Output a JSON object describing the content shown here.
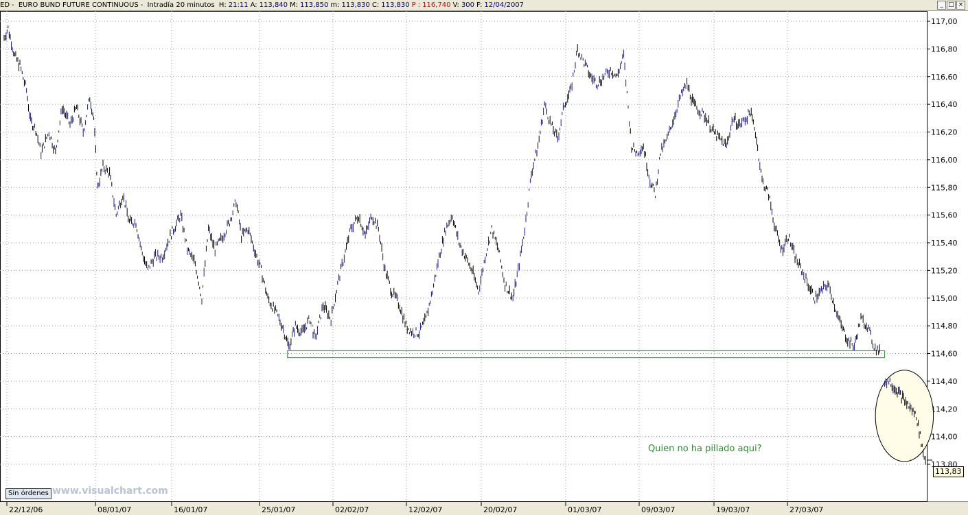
{
  "header": {
    "prefix": "ED",
    "title": "EURO BUND FUTURE CONTINUOUS",
    "interval": "Intradía 20 minutos",
    "items": [
      {
        "label": "H:",
        "value": "21:11",
        "color": "blue"
      },
      {
        "label": "A:",
        "value": "113,840",
        "color": "blue"
      },
      {
        "label": "M:",
        "value": "113,850",
        "color": "blue"
      },
      {
        "label": "m:",
        "value": "113,830",
        "color": "blue"
      },
      {
        "label": "C:",
        "value": "113,830",
        "color": "blue"
      },
      {
        "label": "P :",
        "value": "116,740",
        "color": "red"
      },
      {
        "label": "V:",
        "value": "300",
        "color": "blue"
      },
      {
        "label": "F:",
        "value": "12/04/2007",
        "color": "blue"
      }
    ],
    "window_buttons": [
      "_",
      "□",
      "×"
    ]
  },
  "footer": {
    "orders_badge": "Sin órdenes",
    "watermark": "www.visualchart.com"
  },
  "colors": {
    "up_bar": "#1a1a8c",
    "down_bar": "#000000",
    "grid": "#9a9a9a",
    "support_box": "#3c9b3c",
    "ellipse_fill": "#fffde7",
    "annotation": "#2e8b2e"
  },
  "chart_data": {
    "type": "line",
    "style": "intraday price bars, 20 minutes",
    "ylim": [
      113.8,
      117.1
    ],
    "y_ticks": [
      "113,80",
      "114,00",
      "114,20",
      "114,40",
      "114,60",
      "114,80",
      "115,00",
      "115,20",
      "115,40",
      "115,60",
      "115,80",
      "116,00",
      "116,20",
      "116,40",
      "116,60",
      "116,80",
      "117,00"
    ],
    "x_labels": [
      "22/12/06",
      "08/01/07",
      "16/01/07",
      "25/01/07",
      "02/02/07",
      "12/02/07",
      "20/02/07",
      "01/03/07",
      "09/03/07",
      "19/03/07",
      "27/03/07"
    ],
    "grid": true,
    "series": [
      {
        "points": [
          [
            0,
            116.88
          ],
          [
            0.3,
            116.95
          ],
          [
            0.8,
            116.75
          ],
          [
            1.2,
            116.68
          ],
          [
            1.7,
            116.5
          ],
          [
            2.0,
            116.28
          ],
          [
            2.4,
            116.22
          ],
          [
            2.8,
            116.05
          ],
          [
            3.4,
            116.2
          ],
          [
            3.9,
            116.05
          ],
          [
            4.4,
            116.38
          ],
          [
            5.0,
            116.25
          ],
          [
            5.5,
            116.38
          ],
          [
            6.0,
            116.2
          ],
          [
            6.5,
            116.45
          ],
          [
            6.8,
            116.3
          ],
          [
            7.1,
            115.8
          ],
          [
            7.5,
            115.95
          ],
          [
            8.0,
            115.9
          ],
          [
            8.5,
            115.6
          ],
          [
            9.0,
            115.75
          ],
          [
            9.5,
            115.55
          ],
          [
            10.0,
            115.55
          ],
          [
            10.4,
            115.35
          ],
          [
            10.9,
            115.2
          ],
          [
            11.4,
            115.3
          ],
          [
            12.0,
            115.3
          ],
          [
            12.6,
            115.45
          ],
          [
            13.4,
            115.6
          ],
          [
            13.9,
            115.35
          ],
          [
            14.5,
            115.25
          ],
          [
            15.0,
            115.0
          ],
          [
            15.5,
            115.5
          ],
          [
            16.0,
            115.35
          ],
          [
            16.6,
            115.45
          ],
          [
            17.1,
            115.55
          ],
          [
            17.6,
            115.7
          ],
          [
            18.0,
            115.45
          ],
          [
            18.5,
            115.5
          ],
          [
            19.0,
            115.35
          ],
          [
            19.5,
            115.2
          ],
          [
            20.0,
            115.0
          ],
          [
            20.6,
            114.9
          ],
          [
            21.1,
            114.8
          ],
          [
            21.6,
            114.65
          ],
          [
            22.1,
            114.8
          ],
          [
            22.6,
            114.75
          ],
          [
            23.2,
            114.85
          ],
          [
            23.6,
            114.7
          ],
          [
            24.2,
            114.95
          ],
          [
            24.8,
            114.85
          ],
          [
            25.3,
            115.1
          ],
          [
            25.8,
            115.3
          ],
          [
            26.3,
            115.5
          ],
          [
            26.9,
            115.6
          ],
          [
            27.4,
            115.45
          ],
          [
            27.9,
            115.6
          ],
          [
            28.4,
            115.5
          ],
          [
            28.9,
            115.2
          ],
          [
            29.4,
            115.05
          ],
          [
            30.0,
            114.95
          ],
          [
            30.5,
            114.8
          ],
          [
            31.0,
            114.75
          ],
          [
            31.5,
            114.75
          ],
          [
            32.0,
            114.85
          ],
          [
            32.5,
            115.05
          ],
          [
            33.0,
            115.3
          ],
          [
            33.5,
            115.5
          ],
          [
            34.0,
            115.6
          ],
          [
            34.5,
            115.4
          ],
          [
            35.0,
            115.3
          ],
          [
            35.5,
            115.2
          ],
          [
            36.0,
            115.05
          ],
          [
            36.5,
            115.3
          ],
          [
            37.0,
            115.5
          ],
          [
            37.5,
            115.35
          ],
          [
            38.0,
            115.1
          ],
          [
            38.6,
            115.0
          ],
          [
            39.0,
            115.2
          ],
          [
            39.5,
            115.5
          ],
          [
            40.0,
            115.9
          ],
          [
            40.5,
            116.1
          ],
          [
            41.0,
            116.4
          ],
          [
            41.5,
            116.25
          ],
          [
            42.0,
            116.15
          ],
          [
            42.5,
            116.4
          ],
          [
            43.0,
            116.5
          ],
          [
            43.5,
            116.8
          ],
          [
            44.0,
            116.7
          ],
          [
            44.5,
            116.6
          ],
          [
            45.0,
            116.55
          ],
          [
            45.5,
            116.6
          ],
          [
            46.0,
            116.65
          ],
          [
            46.5,
            116.6
          ],
          [
            47.0,
            116.75
          ],
          [
            47.6,
            116.1
          ],
          [
            48.0,
            116.05
          ],
          [
            48.5,
            116.1
          ],
          [
            49.0,
            115.85
          ],
          [
            49.4,
            115.75
          ],
          [
            49.8,
            116.05
          ],
          [
            50.3,
            116.15
          ],
          [
            50.8,
            116.3
          ],
          [
            51.3,
            116.45
          ],
          [
            51.8,
            116.55
          ],
          [
            52.3,
            116.4
          ],
          [
            52.8,
            116.35
          ],
          [
            53.3,
            116.3
          ],
          [
            53.8,
            116.2
          ],
          [
            54.3,
            116.15
          ],
          [
            54.8,
            116.1
          ],
          [
            55.3,
            116.3
          ],
          [
            55.8,
            116.25
          ],
          [
            56.3,
            116.3
          ],
          [
            56.6,
            116.35
          ],
          [
            57.0,
            116.2
          ],
          [
            57.5,
            115.85
          ],
          [
            58.0,
            115.75
          ],
          [
            58.5,
            115.5
          ],
          [
            59.0,
            115.35
          ],
          [
            59.5,
            115.45
          ],
          [
            60.0,
            115.3
          ],
          [
            60.5,
            115.2
          ],
          [
            61.0,
            115.1
          ],
          [
            61.5,
            115.0
          ],
          [
            62.0,
            115.05
          ],
          [
            62.5,
            115.1
          ],
          [
            63.0,
            114.95
          ],
          [
            63.5,
            114.8
          ],
          [
            64.0,
            114.7
          ],
          [
            64.5,
            114.65
          ],
          [
            65.0,
            114.85
          ],
          [
            65.5,
            114.8
          ],
          [
            66.0,
            114.65
          ],
          [
            66.5,
            114.6
          ]
        ]
      },
      {
        "points": [
          [
            66.8,
            114.4
          ],
          [
            67.2,
            114.4
          ],
          [
            67.6,
            114.35
          ],
          [
            68.0,
            114.3
          ],
          [
            68.4,
            114.25
          ],
          [
            68.8,
            114.2
          ],
          [
            69.2,
            114.15
          ],
          [
            69.5,
            114.0
          ],
          [
            69.8,
            113.85
          ],
          [
            70.0,
            113.83
          ]
        ]
      }
    ],
    "annotations": [
      {
        "type": "support_zone",
        "text": "",
        "y_range": [
          114.57,
          114.62
        ],
        "x_range": [
          21.5,
          66.8
        ]
      },
      {
        "type": "ellipse",
        "text": "",
        "center": [
          68.3,
          114.15
        ],
        "radii": [
          2.2,
          0.33
        ]
      },
      {
        "type": "text",
        "text": "Quien no ha pillado aqui?",
        "at": [
          52.5,
          114.0
        ]
      }
    ],
    "last_price_label": "113,83"
  }
}
